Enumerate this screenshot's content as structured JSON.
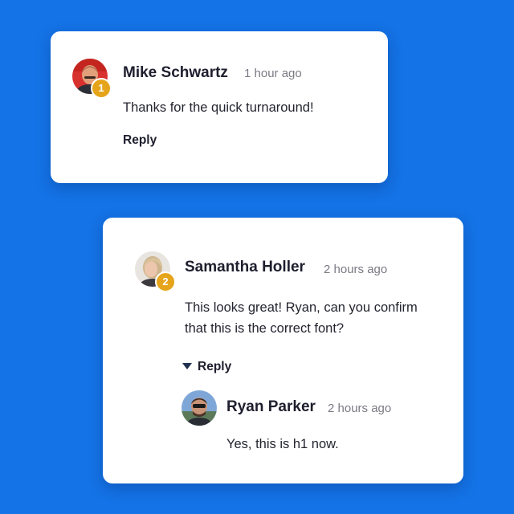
{
  "comments": [
    {
      "author": "Mike Schwartz",
      "time": "1 hour ago",
      "badge": "1",
      "text": "Thanks for the quick turnaround!",
      "reply_label": "Reply"
    },
    {
      "author": "Samantha Holler",
      "time": "2 hours ago",
      "badge": "2",
      "text": "This looks great! Ryan, can you confirm that this is the correct font?",
      "reply_label": "Reply",
      "replies": [
        {
          "author": "Ryan Parker",
          "time": "2 hours ago",
          "text": "Yes, this is h1 now."
        }
      ]
    }
  ],
  "colors": {
    "background": "#1473e6",
    "card": "#ffffff",
    "badge": "#e5a41a",
    "text_primary": "#1e1e2e",
    "text_secondary": "#7a7a84"
  },
  "icons": {
    "collapse_replies": "caret-down-icon"
  }
}
